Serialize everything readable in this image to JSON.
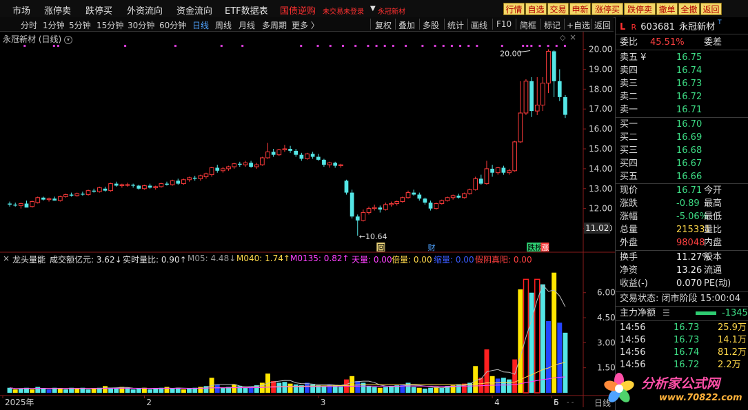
{
  "menu": {
    "items": [
      "市场",
      "涨停卖",
      "跌停买",
      "外资流向",
      "资金流向",
      "ETF数据表"
    ],
    "promo": "国债逆购",
    "login_notice": "未交易未登录",
    "current_stock": "永冠新材"
  },
  "toolbar_buttons": [
    "行情",
    "自选",
    "交易",
    "申新",
    "涨停买",
    "跌停卖",
    "撤单",
    "全撤",
    "返回"
  ],
  "periods": [
    "分时",
    "1分钟",
    "5分钟",
    "15分钟",
    "30分钟",
    "60分钟",
    "日线",
    "周线",
    "月线",
    "多周期",
    "更多 〉"
  ],
  "active_period": "日线",
  "chart_tools": [
    "复权",
    "叠加",
    "多股",
    "统计",
    "画线",
    "F10",
    "简框",
    "标记",
    "+自选",
    "返回"
  ],
  "chart_title": "永冠新材 (日线)",
  "chart_data": [
    {
      "type": "candlestick",
      "title": "永冠新材 (日线)",
      "ylim": [
        10.5,
        20.4
      ],
      "y_ticks": [
        "11.00",
        "12.00",
        "13.00",
        "14.00",
        "15.00",
        "16.00",
        "17.00",
        "18.00",
        "19.00",
        "20.00"
      ],
      "current_price_tag": "11.02",
      "x_tick_labels": [
        "2025年",
        "2",
        "3",
        "4",
        "5",
        "6"
      ],
      "annotations": {
        "high": "20.00",
        "low": "←10.64",
        "markers": [
          "回",
          "财",
          "跌榜",
          "涨"
        ]
      },
      "candles": [
        {
          "o": 12.25,
          "h": 12.35,
          "l": 12.1,
          "c": 12.2
        },
        {
          "o": 12.2,
          "h": 12.3,
          "l": 12.1,
          "c": 12.15
        },
        {
          "o": 12.15,
          "h": 12.3,
          "l": 12.0,
          "c": 12.25
        },
        {
          "o": 12.25,
          "h": 12.4,
          "l": 12.1,
          "c": 12.05
        },
        {
          "o": 12.1,
          "h": 12.4,
          "l": 12.05,
          "c": 12.35
        },
        {
          "o": 12.3,
          "h": 12.6,
          "l": 12.25,
          "c": 12.55
        },
        {
          "o": 12.55,
          "h": 12.6,
          "l": 12.4,
          "c": 12.45
        },
        {
          "o": 12.45,
          "h": 12.55,
          "l": 12.35,
          "c": 12.5
        },
        {
          "o": 12.5,
          "h": 12.6,
          "l": 12.4,
          "c": 12.4
        },
        {
          "o": 12.4,
          "h": 12.65,
          "l": 12.35,
          "c": 12.6
        },
        {
          "o": 12.6,
          "h": 12.75,
          "l": 12.55,
          "c": 12.7
        },
        {
          "o": 12.7,
          "h": 12.8,
          "l": 12.6,
          "c": 12.65
        },
        {
          "o": 12.65,
          "h": 12.8,
          "l": 12.6,
          "c": 12.75
        },
        {
          "o": 12.75,
          "h": 12.85,
          "l": 12.65,
          "c": 12.7
        },
        {
          "o": 12.7,
          "h": 12.95,
          "l": 12.65,
          "c": 12.9
        },
        {
          "o": 12.9,
          "h": 13.0,
          "l": 12.8,
          "c": 12.85
        },
        {
          "o": 12.85,
          "h": 13.1,
          "l": 12.8,
          "c": 13.05
        },
        {
          "o": 13.0,
          "h": 13.1,
          "l": 12.85,
          "c": 12.9
        },
        {
          "o": 12.9,
          "h": 13.3,
          "l": 12.85,
          "c": 13.25
        },
        {
          "o": 13.25,
          "h": 13.35,
          "l": 13.1,
          "c": 13.15
        },
        {
          "o": 13.15,
          "h": 13.25,
          "l": 13.05,
          "c": 13.2
        },
        {
          "o": 13.2,
          "h": 13.3,
          "l": 13.1,
          "c": 13.2
        },
        {
          "o": 13.2,
          "h": 13.25,
          "l": 13.05,
          "c": 13.15
        },
        {
          "o": 13.15,
          "h": 13.2,
          "l": 12.95,
          "c": 13.0
        },
        {
          "o": 13.0,
          "h": 13.2,
          "l": 12.95,
          "c": 13.15
        },
        {
          "o": 13.15,
          "h": 13.25,
          "l": 13.0,
          "c": 13.05
        },
        {
          "o": 13.05,
          "h": 13.15,
          "l": 12.95,
          "c": 13.1
        },
        {
          "o": 13.1,
          "h": 13.3,
          "l": 13.05,
          "c": 13.25
        },
        {
          "o": 13.25,
          "h": 13.35,
          "l": 13.15,
          "c": 13.2
        },
        {
          "o": 13.2,
          "h": 13.45,
          "l": 13.15,
          "c": 13.4
        },
        {
          "o": 13.4,
          "h": 13.5,
          "l": 13.2,
          "c": 13.25
        },
        {
          "o": 13.25,
          "h": 13.5,
          "l": 13.2,
          "c": 13.45
        },
        {
          "o": 13.45,
          "h": 13.6,
          "l": 13.35,
          "c": 13.55
        },
        {
          "o": 13.55,
          "h": 13.65,
          "l": 13.4,
          "c": 13.5
        },
        {
          "o": 13.5,
          "h": 13.7,
          "l": 13.4,
          "c": 13.65
        },
        {
          "o": 13.6,
          "h": 13.8,
          "l": 13.5,
          "c": 13.75
        },
        {
          "o": 13.7,
          "h": 14.1,
          "l": 13.6,
          "c": 14.05
        },
        {
          "o": 14.05,
          "h": 14.2,
          "l": 13.8,
          "c": 13.9
        },
        {
          "o": 13.9,
          "h": 14.1,
          "l": 13.8,
          "c": 14.0
        },
        {
          "o": 14.0,
          "h": 14.15,
          "l": 13.9,
          "c": 14.1
        },
        {
          "o": 14.1,
          "h": 14.3,
          "l": 14.0,
          "c": 14.25
        },
        {
          "o": 14.25,
          "h": 14.35,
          "l": 14.1,
          "c": 14.2
        },
        {
          "o": 14.2,
          "h": 14.4,
          "l": 14.1,
          "c": 14.3
        },
        {
          "o": 14.3,
          "h": 14.4,
          "l": 14.05,
          "c": 14.1
        },
        {
          "o": 14.1,
          "h": 14.3,
          "l": 14.0,
          "c": 14.2
        },
        {
          "o": 14.2,
          "h": 14.6,
          "l": 14.15,
          "c": 14.55
        },
        {
          "o": 14.55,
          "h": 15.3,
          "l": 14.5,
          "c": 14.85
        },
        {
          "o": 14.85,
          "h": 15.0,
          "l": 14.6,
          "c": 14.7
        },
        {
          "o": 14.7,
          "h": 15.0,
          "l": 14.65,
          "c": 14.95
        },
        {
          "o": 14.95,
          "h": 15.2,
          "l": 14.85,
          "c": 15.0
        },
        {
          "o": 15.0,
          "h": 15.15,
          "l": 14.8,
          "c": 14.9
        },
        {
          "o": 14.9,
          "h": 15.0,
          "l": 14.6,
          "c": 14.7
        },
        {
          "o": 14.7,
          "h": 14.8,
          "l": 14.4,
          "c": 14.5
        },
        {
          "o": 14.5,
          "h": 14.8,
          "l": 14.45,
          "c": 14.75
        },
        {
          "o": 14.75,
          "h": 14.85,
          "l": 14.5,
          "c": 14.6
        },
        {
          "o": 14.6,
          "h": 14.75,
          "l": 14.4,
          "c": 14.45
        },
        {
          "o": 14.45,
          "h": 14.5,
          "l": 14.1,
          "c": 14.2
        },
        {
          "o": 14.2,
          "h": 14.35,
          "l": 14.05,
          "c": 14.3
        },
        {
          "o": 14.3,
          "h": 14.35,
          "l": 14.05,
          "c": 14.15
        },
        {
          "o": 14.15,
          "h": 14.25,
          "l": 14.05,
          "c": 14.2
        },
        {
          "o": 13.4,
          "h": 13.45,
          "l": 12.7,
          "c": 12.8
        },
        {
          "o": 12.8,
          "h": 12.95,
          "l": 11.5,
          "c": 11.6
        },
        {
          "o": 11.6,
          "h": 11.7,
          "l": 10.64,
          "c": 11.4
        },
        {
          "o": 11.4,
          "h": 11.95,
          "l": 11.35,
          "c": 11.8
        },
        {
          "o": 11.8,
          "h": 12.1,
          "l": 11.7,
          "c": 12.0
        },
        {
          "o": 12.0,
          "h": 12.2,
          "l": 11.9,
          "c": 12.05
        },
        {
          "o": 12.05,
          "h": 12.15,
          "l": 11.8,
          "c": 11.95
        },
        {
          "o": 11.95,
          "h": 12.3,
          "l": 11.9,
          "c": 12.2
        },
        {
          "o": 12.2,
          "h": 12.35,
          "l": 12.1,
          "c": 12.25
        },
        {
          "o": 12.25,
          "h": 12.4,
          "l": 12.15,
          "c": 12.35
        },
        {
          "o": 12.35,
          "h": 12.6,
          "l": 12.3,
          "c": 12.55
        },
        {
          "o": 12.55,
          "h": 12.9,
          "l": 12.5,
          "c": 12.8
        },
        {
          "o": 12.8,
          "h": 12.95,
          "l": 12.65,
          "c": 12.7
        },
        {
          "o": 12.7,
          "h": 12.8,
          "l": 12.4,
          "c": 12.5
        },
        {
          "o": 12.5,
          "h": 12.55,
          "l": 12.2,
          "c": 12.3
        },
        {
          "o": 12.3,
          "h": 12.4,
          "l": 11.9,
          "c": 12.0
        },
        {
          "o": 12.0,
          "h": 12.3,
          "l": 11.95,
          "c": 12.25
        },
        {
          "o": 12.25,
          "h": 12.45,
          "l": 12.2,
          "c": 12.4
        },
        {
          "o": 12.4,
          "h": 12.6,
          "l": 12.35,
          "c": 12.55
        },
        {
          "o": 12.55,
          "h": 12.7,
          "l": 12.45,
          "c": 12.65
        },
        {
          "o": 12.65,
          "h": 12.75,
          "l": 12.5,
          "c": 12.55
        },
        {
          "o": 12.55,
          "h": 12.8,
          "l": 12.5,
          "c": 12.75
        },
        {
          "o": 12.75,
          "h": 13.0,
          "l": 12.7,
          "c": 12.95
        },
        {
          "o": 12.95,
          "h": 13.6,
          "l": 12.9,
          "c": 13.5
        },
        {
          "o": 13.5,
          "h": 13.7,
          "l": 13.2,
          "c": 13.25
        },
        {
          "o": 13.25,
          "h": 14.4,
          "l": 13.2,
          "c": 14.0
        },
        {
          "o": 14.0,
          "h": 14.2,
          "l": 13.6,
          "c": 13.8
        },
        {
          "o": 13.8,
          "h": 14.1,
          "l": 13.7,
          "c": 14.05
        },
        {
          "o": 14.05,
          "h": 14.15,
          "l": 13.7,
          "c": 13.8
        },
        {
          "o": 13.8,
          "h": 14.0,
          "l": 13.7,
          "c": 13.9
        },
        {
          "o": 13.9,
          "h": 15.4,
          "l": 13.85,
          "c": 15.35
        },
        {
          "o": 15.35,
          "h": 18.4,
          "l": 15.3,
          "c": 16.8
        },
        {
          "o": 16.8,
          "h": 18.5,
          "l": 16.7,
          "c": 18.4
        },
        {
          "o": 18.4,
          "h": 18.6,
          "l": 16.6,
          "c": 16.9
        },
        {
          "o": 16.9,
          "h": 18.6,
          "l": 16.7,
          "c": 17.2
        },
        {
          "o": 17.2,
          "h": 18.6,
          "l": 16.9,
          "c": 18.3
        },
        {
          "o": 18.3,
          "h": 20.0,
          "l": 17.8,
          "c": 19.9
        },
        {
          "o": 19.9,
          "h": 19.95,
          "l": 17.6,
          "c": 18.4
        },
        {
          "o": 18.4,
          "h": 19.0,
          "l": 17.4,
          "c": 17.6
        },
        {
          "o": 17.6,
          "h": 17.7,
          "l": 16.55,
          "c": 16.71
        }
      ],
      "series_colors": {
        "up": "#ff3b3b",
        "down": "#54e6e6"
      }
    },
    {
      "type": "bar",
      "title": "龙头量能",
      "ylim": [
        0,
        7.6
      ],
      "y_ticks": [
        "1.50",
        "3.00",
        "4.50",
        "6.00"
      ],
      "volumes": [
        0.3,
        0.2,
        0.25,
        0.3,
        0.2,
        0.35,
        0.25,
        0.2,
        0.3,
        0.25,
        0.2,
        0.3,
        0.25,
        0.3,
        0.2,
        0.25,
        0.3,
        0.4,
        0.3,
        0.25,
        0.35,
        0.3,
        0.2,
        0.25,
        0.3,
        0.2,
        0.25,
        0.3,
        0.35,
        0.25,
        0.3,
        0.2,
        0.25,
        0.3,
        0.35,
        0.4,
        0.9,
        0.5,
        0.3,
        0.35,
        0.5,
        0.4,
        0.3,
        0.35,
        0.45,
        0.6,
        1.15,
        0.7,
        0.6,
        0.65,
        0.55,
        0.5,
        0.45,
        0.6,
        0.5,
        0.45,
        0.4,
        0.5,
        0.45,
        0.4,
        0.8,
        1.0,
        0.7,
        0.6,
        0.4,
        0.35,
        0.3,
        0.35,
        0.4,
        0.45,
        0.5,
        0.6,
        0.35,
        0.3,
        0.25,
        0.3,
        0.35,
        0.3,
        0.4,
        0.45,
        0.5,
        0.55,
        0.6,
        1.6,
        0.9,
        2.6,
        1.0,
        0.85,
        0.9,
        0.8,
        2.0,
        6.2,
        6.8,
        6.0,
        6.8,
        6.5,
        4.3,
        7.2,
        4.2,
        3.6
      ],
      "vol_colors": [
        "c",
        "y",
        "c",
        "c",
        "y",
        "c",
        "c",
        "b",
        "c",
        "y",
        "c",
        "c",
        "y",
        "c",
        "c",
        "y",
        "c",
        "y",
        "c",
        "c",
        "y",
        "c",
        "c",
        "c",
        "y",
        "c",
        "c",
        "c",
        "y",
        "c",
        "c",
        "y",
        "c",
        "c",
        "y",
        "c",
        "y",
        "b",
        "c",
        "c",
        "y",
        "c",
        "c",
        "b",
        "c",
        "y",
        "y",
        "r",
        "c",
        "c",
        "y",
        "c",
        "c",
        "b",
        "c",
        "c",
        "c",
        "b",
        "c",
        "c",
        "r",
        "y",
        "b",
        "c",
        "c",
        "c",
        "y",
        "c",
        "c",
        "c",
        "b",
        "c",
        "c",
        "y",
        "c",
        "c",
        "y",
        "c",
        "c",
        "y",
        "c",
        "r",
        "c",
        "y",
        "r",
        "r",
        "y",
        "b",
        "c",
        "c",
        "r",
        "y",
        "r",
        "c",
        "r",
        "c",
        "b",
        "y",
        "b",
        "c"
      ],
      "ma_line_colors": {
        "m05": "#bbbbbb",
        "m040": "#ffd84a",
        "m0135": "#ff40ff"
      }
    }
  ],
  "indicator_bar": {
    "name": "龙头量能",
    "items": [
      {
        "text": "成交额亿元: 3.62↓",
        "color": "#e0e0e0"
      },
      {
        "text": "实时量比: 0.90↑",
        "color": "#e0e0e0"
      },
      {
        "text": "M05: 4.48↓",
        "color": "#9a9a9a"
      },
      {
        "text": "M040: 1.74↑",
        "color": "#ffd84a"
      },
      {
        "text": "M0135: 0.82↑",
        "color": "#ff40ff"
      },
      {
        "text": "天量: 0.00",
        "color": "#ff40ff"
      },
      {
        "text": "倍量: 0.00",
        "color": "#ffd84a"
      },
      {
        "text": "缩量: 0.00",
        "color": "#3a5bff"
      },
      {
        "text": "假阴真阳: 0.00",
        "color": "#ff4040"
      }
    ]
  },
  "quote": {
    "code": "603681",
    "name": "永冠新材",
    "wei_bi_label": "委比",
    "wei_bi": "45.51%",
    "wei_cha_label": "委差",
    "sell": [
      {
        "label": "卖五 ¥",
        "price": "16.75"
      },
      {
        "label": "卖四",
        "price": "16.74"
      },
      {
        "label": "卖三",
        "price": "16.73"
      },
      {
        "label": "卖二",
        "price": "16.72"
      },
      {
        "label": "卖一",
        "price": "16.71"
      }
    ],
    "buy": [
      {
        "label": "买一",
        "price": "16.70"
      },
      {
        "label": "买二",
        "price": "16.69"
      },
      {
        "label": "买三",
        "price": "16.68"
      },
      {
        "label": "买四",
        "price": "16.67"
      },
      {
        "label": "买五",
        "price": "16.66"
      }
    ],
    "stats": [
      {
        "label": "现价",
        "value": "16.71",
        "tail": "今开",
        "color": "#3ddc84"
      },
      {
        "label": "涨跌",
        "value": "-0.89",
        "tail": "最高",
        "color": "#3ddc84"
      },
      {
        "label": "涨幅",
        "value": "-5.06%",
        "tail": "最低",
        "color": "#3ddc84"
      },
      {
        "label": "总量",
        "value": "215331",
        "tail": "量比",
        "color": "#ffd84a"
      },
      {
        "label": "外盘",
        "value": "98048",
        "tail": "内盘",
        "color": "#ff4040"
      }
    ],
    "stats2": [
      {
        "label": "换手",
        "value": "11.27%",
        "tail": "股本",
        "color": "#e8e8e8"
      },
      {
        "label": "净资",
        "value": "13.26",
        "tail": "流通",
        "color": "#e8e8e8"
      },
      {
        "label": "收益(-)",
        "value": "0.070",
        "tail": "PE(动)",
        "color": "#e8e8e8"
      }
    ],
    "trade_status": "交易状态: 闭市阶段 15:00:04",
    "main_net_label": "主力净额",
    "main_net_value": "-1345",
    "ticks": [
      {
        "time": "14:56",
        "price": "16.73",
        "vol": "25.9万"
      },
      {
        "time": "14:56",
        "price": "16.73",
        "vol": "14.1万"
      },
      {
        "time": "14:56",
        "price": "16.74",
        "vol": "81.2万"
      },
      {
        "time": "14:56",
        "price": "16.72",
        "vol": "2.2万"
      }
    ]
  },
  "watermark": {
    "brand": "分析家公式网",
    "url": "www.70822.com"
  },
  "bottom_tab": "日线"
}
